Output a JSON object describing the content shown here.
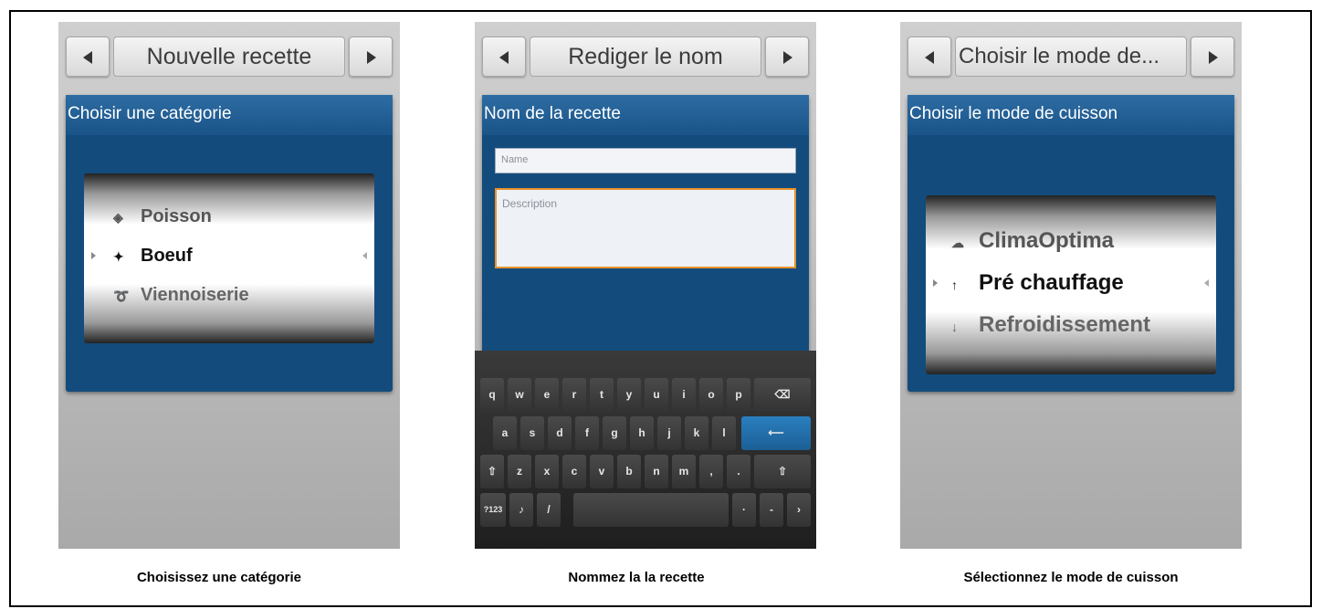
{
  "screens": [
    {
      "header_title": "Nouvelle recette",
      "panel_title": "Choisir une catégorie",
      "picker": {
        "above": {
          "label": "Poisson",
          "icon": "fish-icon"
        },
        "selected": {
          "label": "Boeuf",
          "icon": "beef-icon"
        },
        "below": {
          "label": "Viennoiserie",
          "icon": "croissant-icon"
        }
      },
      "caption": "Choisissez une catégorie"
    },
    {
      "header_title": "Rediger le nom",
      "panel_title": "Nom de la recette",
      "name_placeholder": "Name",
      "description_placeholder": "Description",
      "keyboard": {
        "row1": [
          "q",
          "w",
          "e",
          "r",
          "t",
          "y",
          "u",
          "i",
          "o",
          "p"
        ],
        "row2": [
          "a",
          "s",
          "d",
          "f",
          "g",
          "h",
          "j",
          "k",
          "l"
        ],
        "row3": [
          "z",
          "x",
          "c",
          "v",
          "b",
          "n",
          "m",
          ",",
          "."
        ],
        "bottom_label": "?123"
      },
      "caption": "Nommez la la recette"
    },
    {
      "header_title": "Choisir le mode de...",
      "panel_title": "Choisir le mode de cuisson",
      "picker": {
        "above": {
          "label": "ClimaOptima",
          "icon": "steam-icon"
        },
        "selected": {
          "label": "Pré chauffage",
          "icon": "thermometer-up-icon"
        },
        "below": {
          "label": "Refroidissement",
          "icon": "thermometer-down-icon"
        }
      },
      "caption": "Sélectionnez le mode de cuisson"
    }
  ],
  "colors": {
    "panel_blue": "#134c7c",
    "panel_header_blue": "#2d6ca3",
    "input_focus_orange": "#e8922d",
    "enter_key_blue": "#2a7fbf"
  }
}
